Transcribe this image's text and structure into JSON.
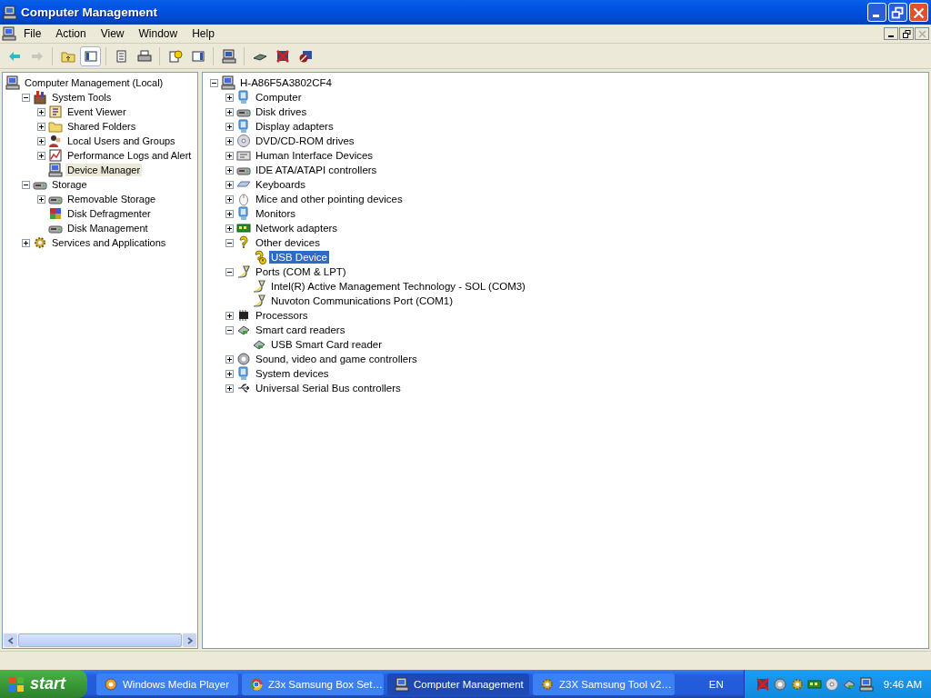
{
  "window": {
    "title": "Computer Management"
  },
  "menu": [
    "File",
    "Action",
    "View",
    "Window",
    "Help"
  ],
  "toolbar": [
    {
      "kind": "back",
      "disabled": false,
      "pressed": false
    },
    {
      "kind": "forward",
      "disabled": true,
      "pressed": false
    },
    {
      "kind": "up",
      "disabled": false,
      "pressed": false
    },
    {
      "kind": "tree",
      "disabled": false,
      "pressed": true
    },
    {
      "kind": "properties",
      "disabled": false,
      "pressed": false
    },
    {
      "kind": "print",
      "disabled": false,
      "pressed": false
    },
    {
      "kind": "help",
      "disabled": false,
      "pressed": false
    },
    {
      "kind": "pane",
      "disabled": false,
      "pressed": false
    },
    {
      "kind": "scan",
      "disabled": false,
      "pressed": false
    },
    {
      "kind": "update",
      "disabled": false,
      "pressed": false
    },
    {
      "kind": "uninstall",
      "disabled": false,
      "pressed": false
    },
    {
      "kind": "disable",
      "disabled": false,
      "pressed": false
    }
  ],
  "left_tree": [
    {
      "label": "Computer Management (Local)",
      "kind": "computer",
      "selected": false,
      "children": [
        {
          "label": "System Tools",
          "kind": "tools",
          "selected": false,
          "expanded": true,
          "children": [
            {
              "label": "Event Viewer",
              "kind": "log",
              "selected": false,
              "expanded": false
            },
            {
              "label": "Shared Folders",
              "kind": "folder",
              "selected": false,
              "expanded": false
            },
            {
              "label": "Local Users and Groups",
              "kind": "users",
              "selected": false,
              "expanded": false
            },
            {
              "label": "Performance Logs and Alert",
              "kind": "chart",
              "selected": false,
              "expanded": false
            },
            {
              "label": "Device Manager",
              "kind": "computer",
              "selected": true
            }
          ]
        },
        {
          "label": "Storage",
          "kind": "storage",
          "selected": false,
          "expanded": true,
          "children": [
            {
              "label": "Removable Storage",
              "kind": "disk",
              "selected": false,
              "expanded": false
            },
            {
              "label": "Disk Defragmenter",
              "kind": "defrag",
              "selected": false
            },
            {
              "label": "Disk Management",
              "kind": "disk",
              "selected": false
            }
          ]
        },
        {
          "label": "Services and Applications",
          "kind": "gear",
          "selected": false,
          "expanded": false
        }
      ]
    }
  ],
  "right_tree": [
    {
      "label": "H-A86F5A3802CF4",
      "kind": "computer",
      "selected": false,
      "expanded": true,
      "children": [
        {
          "label": "Computer",
          "kind": "monitor",
          "selected": false,
          "expanded": false
        },
        {
          "label": "Disk drives",
          "kind": "drive",
          "selected": false,
          "expanded": false
        },
        {
          "label": "Display adapters",
          "kind": "monitor",
          "selected": false,
          "expanded": false
        },
        {
          "label": "DVD/CD-ROM drives",
          "kind": "cd",
          "selected": false,
          "expanded": false
        },
        {
          "label": "Human Interface Devices",
          "kind": "hid",
          "selected": false,
          "expanded": false
        },
        {
          "label": "IDE ATA/ATAPI controllers",
          "kind": "drive",
          "selected": false,
          "expanded": false
        },
        {
          "label": "Keyboards",
          "kind": "keyboard",
          "selected": false,
          "expanded": false
        },
        {
          "label": "Mice and other pointing devices",
          "kind": "mouse",
          "selected": false,
          "expanded": false
        },
        {
          "label": "Monitors",
          "kind": "monitor",
          "selected": false,
          "expanded": false
        },
        {
          "label": "Network adapters",
          "kind": "network",
          "selected": false,
          "expanded": false
        },
        {
          "label": "Other devices",
          "kind": "unknown",
          "selected": false,
          "expanded": true,
          "children": [
            {
              "label": "USB Device",
              "kind": "warning",
              "selected": true
            }
          ]
        },
        {
          "label": "Ports (COM & LPT)",
          "kind": "port",
          "selected": false,
          "expanded": true,
          "children": [
            {
              "label": "Intel(R) Active Management Technology - SOL (COM3)",
              "kind": "port",
              "selected": false
            },
            {
              "label": "Nuvoton Communications Port (COM1)",
              "kind": "port",
              "selected": false
            }
          ]
        },
        {
          "label": "Processors",
          "kind": "chip",
          "selected": false,
          "expanded": false
        },
        {
          "label": "Smart card readers",
          "kind": "card",
          "selected": false,
          "expanded": true,
          "children": [
            {
              "label": "USB Smart Card reader",
              "kind": "card",
              "selected": false
            }
          ]
        },
        {
          "label": "Sound, video and game controllers",
          "kind": "speaker",
          "selected": false,
          "expanded": false
        },
        {
          "label": "System devices",
          "kind": "monitor",
          "selected": false,
          "expanded": false
        },
        {
          "label": "Universal Serial Bus controllers",
          "kind": "usb",
          "selected": false,
          "expanded": false
        }
      ]
    }
  ],
  "taskbar": {
    "start": "start",
    "tasks": [
      {
        "label": "Windows Media Player",
        "kind": "media",
        "selected": false
      },
      {
        "label": "Z3x Samsung Box Set…",
        "kind": "browser",
        "selected": false
      },
      {
        "label": "Computer Management",
        "kind": "computer",
        "selected": true
      },
      {
        "label": "Z3X Samsung Tool v2…",
        "kind": "tool",
        "selected": false
      }
    ],
    "language": "EN",
    "clock": "9:46 AM"
  }
}
